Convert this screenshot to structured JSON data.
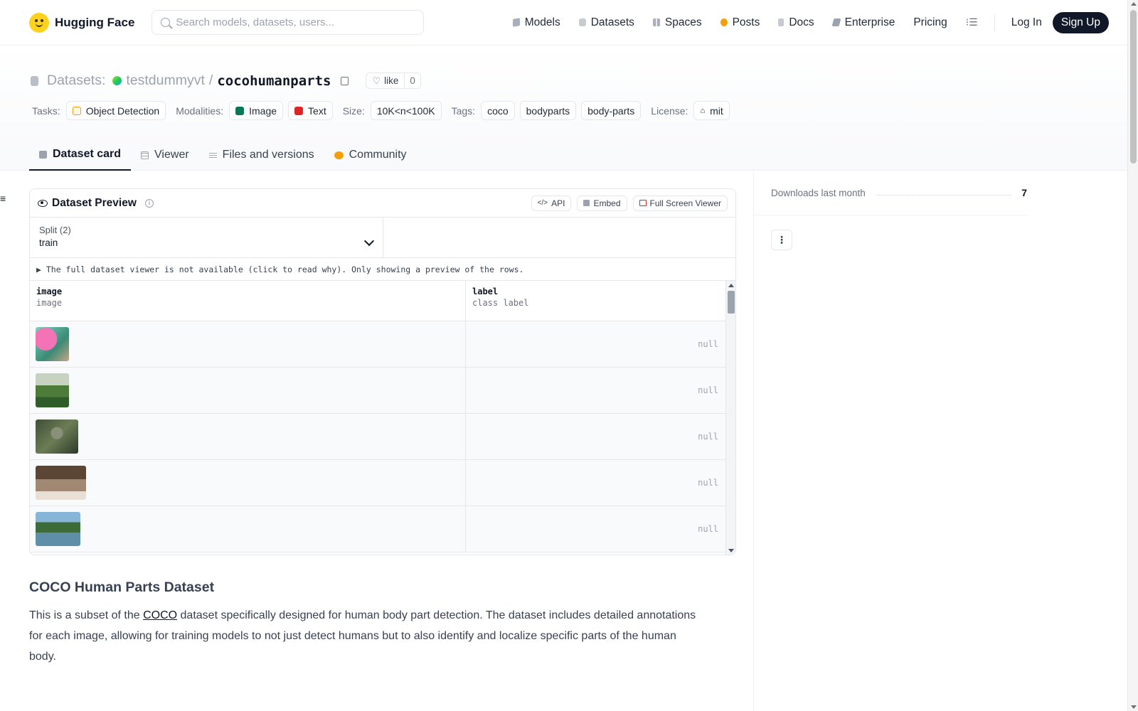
{
  "header": {
    "brand": "Hugging Face",
    "search_placeholder": "Search models, datasets, users...",
    "nav": [
      {
        "label": "Models",
        "icon": "models-icon",
        "color": "#9ca3af"
      },
      {
        "label": "Datasets",
        "icon": "datasets-icon",
        "color": "#c7cbd1"
      },
      {
        "label": "Spaces",
        "icon": "spaces-icon",
        "color": "#aab0ba"
      },
      {
        "label": "Posts",
        "icon": "posts-icon",
        "color": "#f59e0b"
      },
      {
        "label": "Docs",
        "icon": "docs-icon",
        "color": "#b9bec7"
      },
      {
        "label": "Enterprise",
        "icon": "enterprise-icon",
        "color": "#6b7280"
      },
      {
        "label": "Pricing"
      }
    ],
    "login": "Log In",
    "signup": "Sign Up"
  },
  "dataset": {
    "section": "Datasets:",
    "owner": "testdummyvt",
    "separator": "/",
    "name": "cocohumanparts",
    "like_label": "like",
    "like_count": "0"
  },
  "meta": {
    "tasks_label": "Tasks:",
    "task": "Object Detection",
    "modalities_label": "Modalities:",
    "modalities": [
      "Image",
      "Text"
    ],
    "size_label": "Size:",
    "size": "10K<n<100K",
    "tags_label": "Tags:",
    "tags": [
      "coco",
      "bodyparts",
      "body-parts"
    ],
    "license_label": "License:",
    "license": "mit"
  },
  "tabs": [
    {
      "label": "Dataset card",
      "active": true
    },
    {
      "label": "Viewer"
    },
    {
      "label": "Files and versions"
    },
    {
      "label": "Community"
    }
  ],
  "preview": {
    "title": "Dataset Preview",
    "api": "API",
    "embed": "Embed",
    "fullscreen": "Full Screen Viewer",
    "split_label": "Split (2)",
    "split_value": "train",
    "notice": "▶ The full dataset viewer is not available (click to read why). Only showing a preview of the rows.",
    "columns": [
      {
        "name": "image",
        "type": "image"
      },
      {
        "name": "label",
        "type": "class label"
      }
    ],
    "rows": [
      {
        "label": "null"
      },
      {
        "label": "null"
      },
      {
        "label": "null"
      },
      {
        "label": "null"
      },
      {
        "label": "null"
      }
    ]
  },
  "card": {
    "heading": "COCO Human Parts Dataset",
    "p_before": "This is a subset of the ",
    "p_link": "COCO",
    "p_after": " dataset specifically designed for human body part detection. The dataset includes detailed annotations for each image, allowing for training models to not just detect humans but to also identify and localize specific parts of the human body."
  },
  "sidebar": {
    "downloads_label": "Downloads last month",
    "downloads_value": "7"
  },
  "colors": {
    "accent_dark": "#111827",
    "muted": "#9ca3af",
    "border": "#e5e7eb"
  }
}
